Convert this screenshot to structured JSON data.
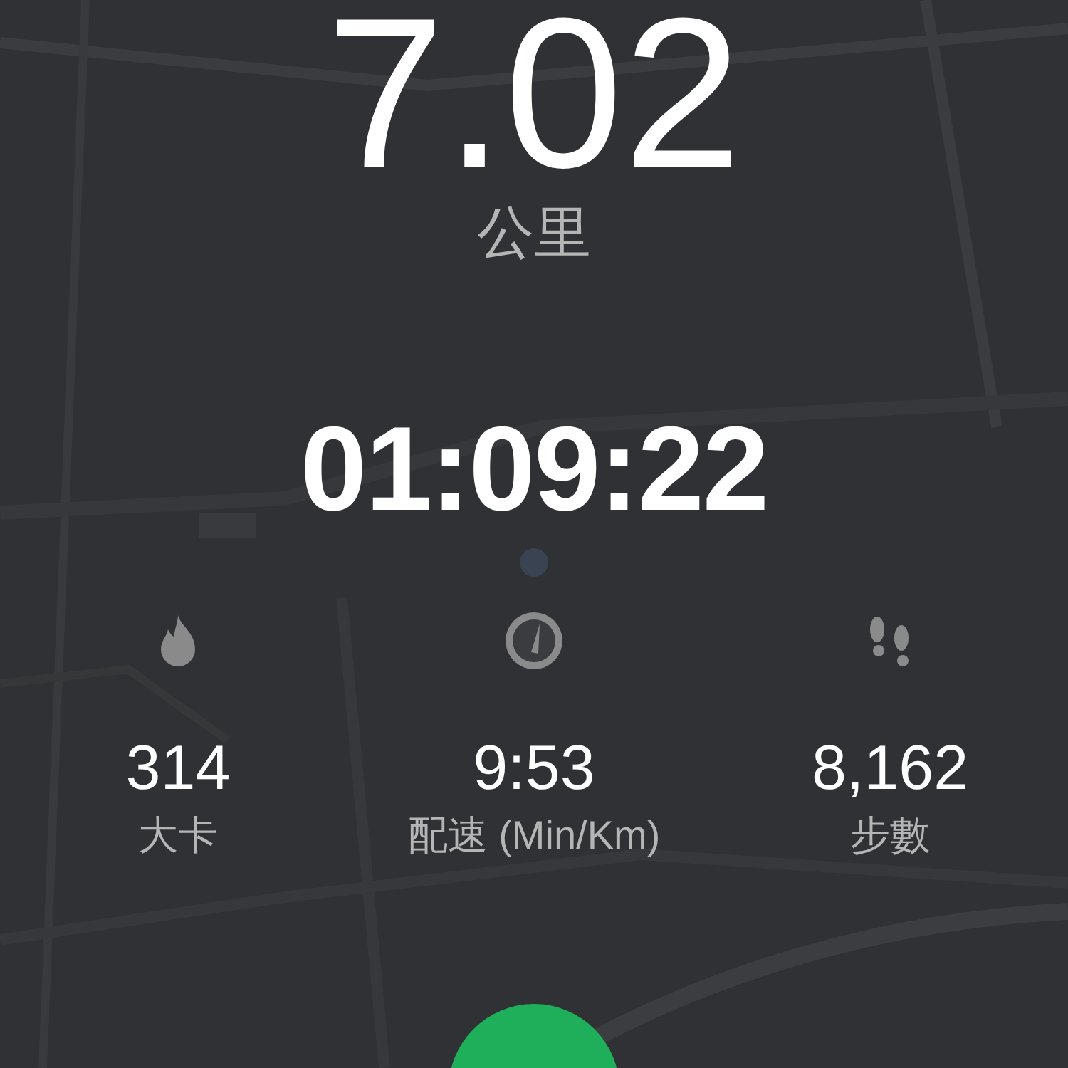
{
  "distance": {
    "value": "7.02",
    "unit": "公里"
  },
  "duration": "01:09:22",
  "stats": [
    {
      "kind": "calories",
      "value": "314",
      "label": "大卡"
    },
    {
      "kind": "pace",
      "value": "9:53",
      "label": "配速 (Min/Km)"
    },
    {
      "kind": "steps",
      "value": "8,162",
      "label": "步數"
    }
  ]
}
